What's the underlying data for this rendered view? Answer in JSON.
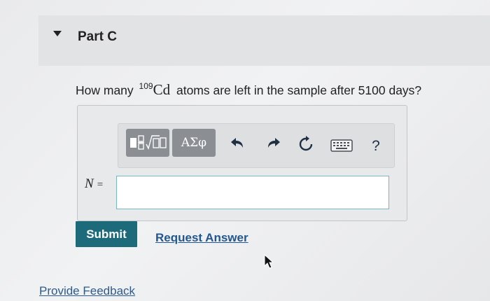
{
  "part": {
    "title": "Part C"
  },
  "question": {
    "prefix": "How many",
    "mass_number": "109",
    "element": "Cd",
    "suffix": "atoms are left in the sample after 5100 days?"
  },
  "toolbar": {
    "greek_label": "ΑΣφ",
    "help_label": "?",
    "icons": [
      "templates-icon",
      "undo-icon",
      "redo-icon",
      "reset-icon",
      "keyboard-icon",
      "help-icon"
    ]
  },
  "answer": {
    "variable_label": "N",
    "equals": "=",
    "value": ""
  },
  "actions": {
    "submit_label": "Submit",
    "request_label": "Request Answer",
    "feedback_label": "Provide Feedback"
  },
  "colors": {
    "submit": "#1d6b7a",
    "link": "#23578f",
    "toolbar_button": "#8b8f94",
    "input_border": "#78b6c2"
  }
}
